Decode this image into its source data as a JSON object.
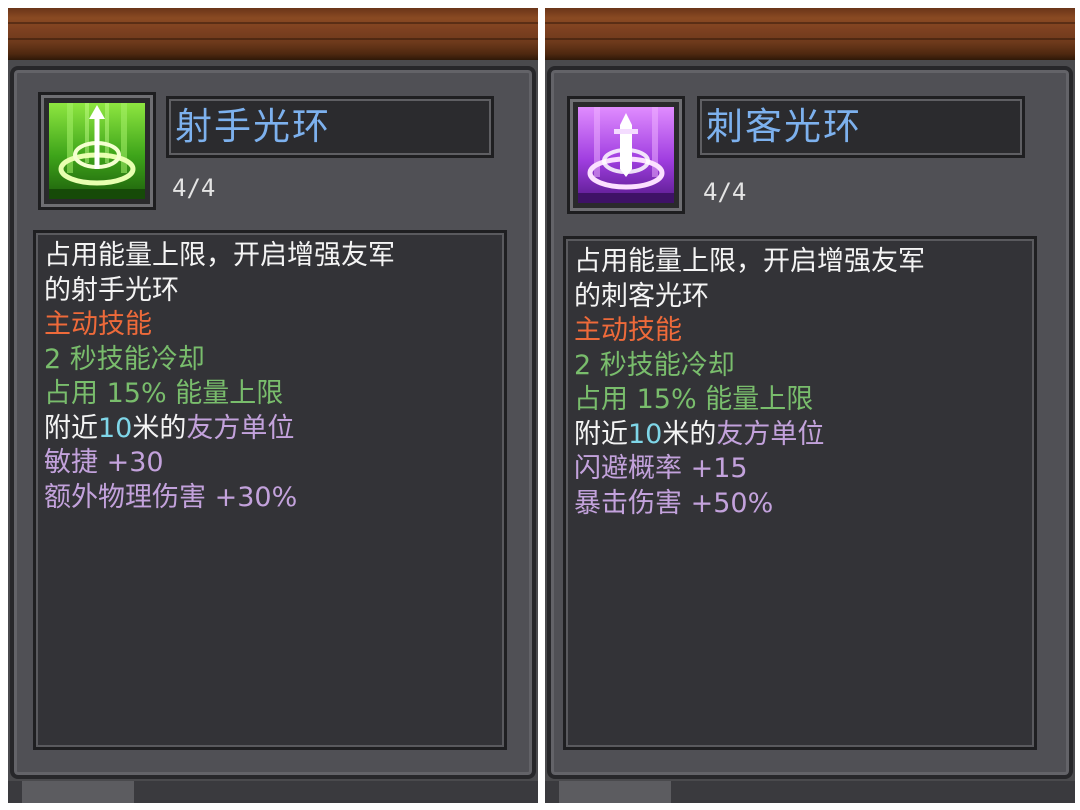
{
  "panels": [
    {
      "icon": "archer-aura-icon",
      "accent": "#4fc21f",
      "title": "射手光环",
      "level": "4/4",
      "desc_line1": "占用能量上限，开启增强友军",
      "desc_line2": "的射手光环",
      "skill_type": "主动技能",
      "cooldown": "2 秒技能冷却",
      "energy_a": "占用",
      "energy_b": "15%",
      "energy_c": "能量上限",
      "range_a": "附近",
      "range_num": "10",
      "range_b": "米的",
      "range_c": "友方单位",
      "bonus1_name": "敏捷",
      "bonus1_value": "+30",
      "bonus2_name": "额外物理伤害",
      "bonus2_value": "+30%"
    },
    {
      "icon": "assassin-aura-icon",
      "accent": "#b046e8",
      "title": "刺客光环",
      "level": "4/4",
      "desc_line1": "占用能量上限，开启增强友军",
      "desc_line2": "的刺客光环",
      "skill_type": "主动技能",
      "cooldown": "2 秒技能冷却",
      "energy_a": "占用",
      "energy_b": "15%",
      "energy_c": "能量上限",
      "range_a": "附近",
      "range_num": "10",
      "range_b": "米的",
      "range_c": "友方单位",
      "bonus1_name": "闪避概率",
      "bonus1_value": "+15",
      "bonus2_name": "暴击伤害",
      "bonus2_value": "+50%"
    }
  ]
}
